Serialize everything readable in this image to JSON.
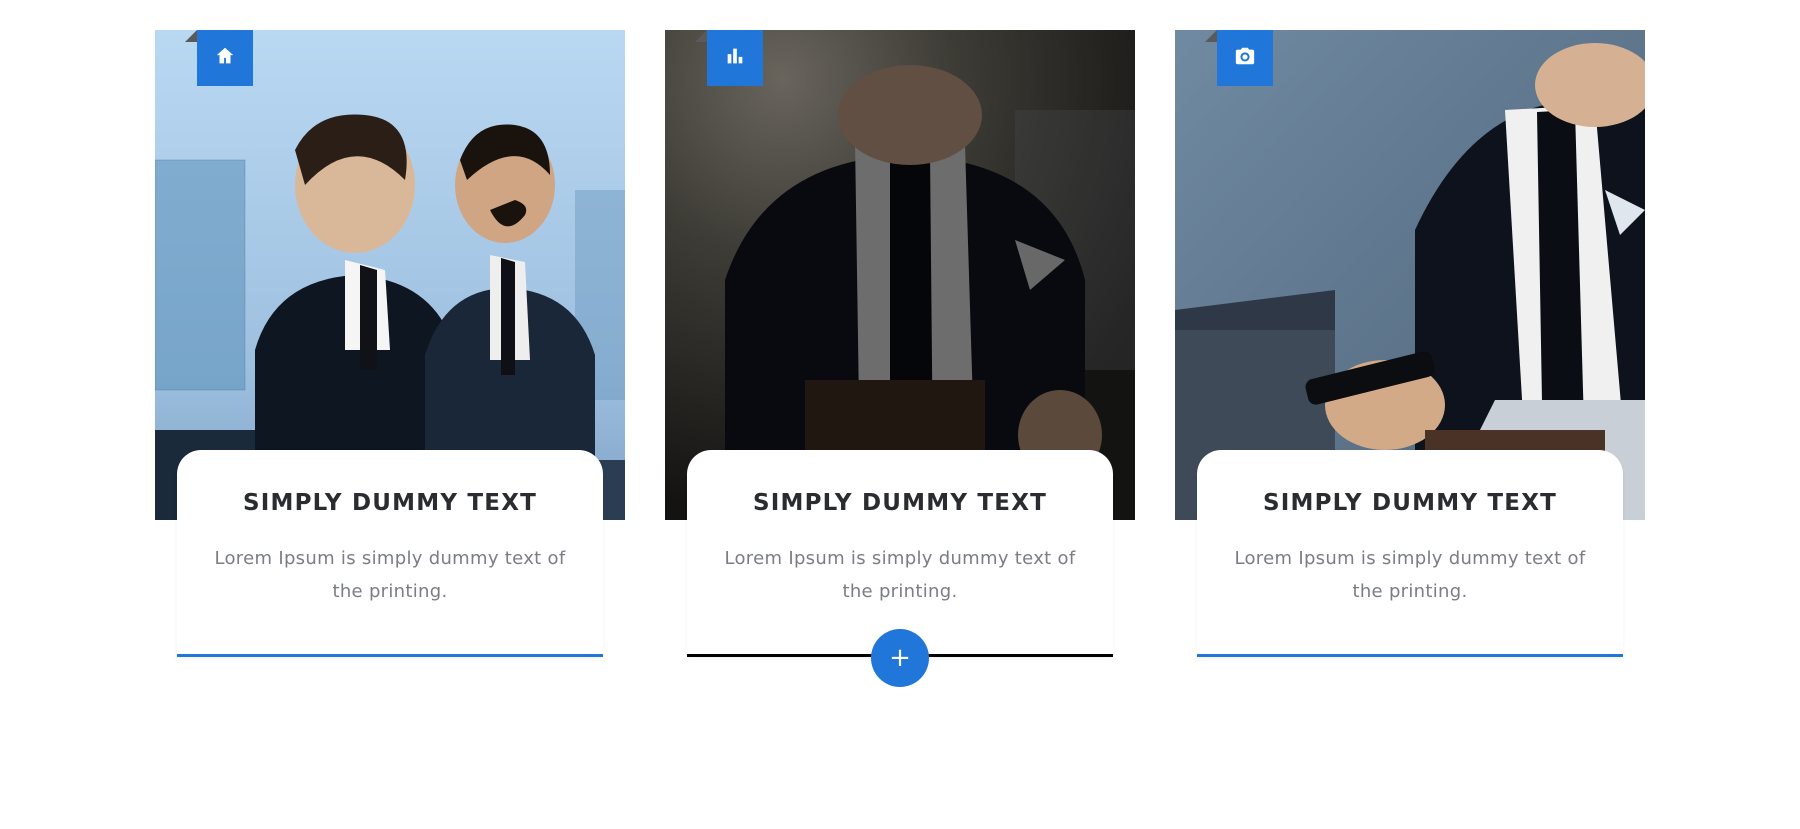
{
  "colors": {
    "accent": "#2076d9"
  },
  "cards": [
    {
      "icon": "home-icon",
      "title": "SIMPLY DUMMY TEXT",
      "description": "Lorem Ipsum is simply dummy text of the printing.",
      "active": false
    },
    {
      "icon": "chart-icon",
      "title": "SIMPLY DUMMY TEXT",
      "description": "Lorem Ipsum is simply dummy text of the printing.",
      "active": true,
      "plus_label": "+"
    },
    {
      "icon": "camera-icon",
      "title": "SIMPLY DUMMY TEXT",
      "description": "Lorem Ipsum is simply dummy text of the printing.",
      "active": false
    }
  ]
}
